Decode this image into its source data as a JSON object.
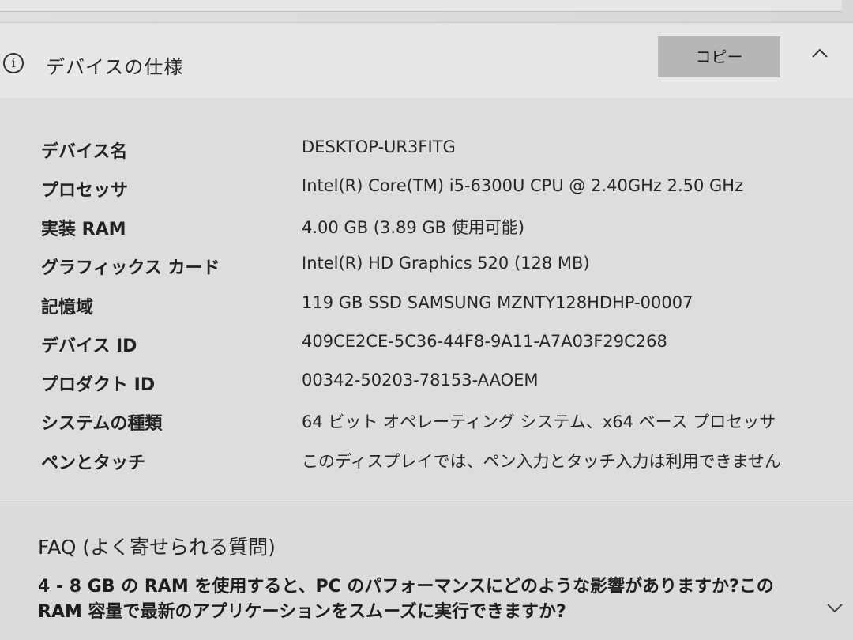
{
  "header": {
    "title": "デバイスの仕様",
    "copy_label": "コピー"
  },
  "specs": [
    {
      "label": "デバイス名",
      "value": "DESKTOP-UR3FITG"
    },
    {
      "label": "プロセッサ",
      "value": "Intel(R) Core(TM) i5-6300U CPU @ 2.40GHz   2.50 GHz"
    },
    {
      "label": "実装 RAM",
      "value": "4.00 GB (3.89 GB 使用可能)"
    },
    {
      "label": "グラフィックス カード",
      "value": "Intel(R) HD Graphics 520 (128 MB)"
    },
    {
      "label": "記憶域",
      "value": "119 GB SSD SAMSUNG MZNTY128HDHP-00007"
    },
    {
      "label": "デバイス ID",
      "value": "409CE2CE-5C36-44F8-9A11-A7A03F29C268"
    },
    {
      "label": "プロダクト ID",
      "value": "00342-50203-78153-AAOEM"
    },
    {
      "label": "システムの種類",
      "value": "64 ビット オペレーティング システム、x64 ベース プロセッサ"
    },
    {
      "label": "ペンとタッチ",
      "value": "このディスプレイでは、ペン入力とタッチ入力は利用できません"
    }
  ],
  "faq": {
    "title": "FAQ (よく寄せられる質問)",
    "question": "4 - 8 GB の RAM を使用すると、PC のパフォーマンスにどのような影響がありますか?この RAM 容量で最新のアプリケーションをスムーズに実行できますか?"
  },
  "icons": {
    "info": "info-icon",
    "collapse": "chevron-up-icon",
    "expand": "chevron-down-icon"
  }
}
